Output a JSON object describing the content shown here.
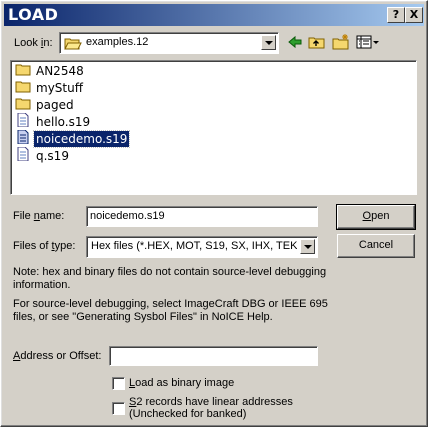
{
  "window": {
    "title": "LOAD",
    "help_btn": "?",
    "close_btn": "X"
  },
  "lookin": {
    "label_pre": "Look ",
    "label_u": "i",
    "label_post": "n:",
    "value": "examples.12"
  },
  "files": [
    {
      "name": "AN2548",
      "type": "folder",
      "selected": false
    },
    {
      "name": "myStuff",
      "type": "folder",
      "selected": false
    },
    {
      "name": "paged",
      "type": "folder",
      "selected": false
    },
    {
      "name": "hello.s19",
      "type": "file",
      "selected": false
    },
    {
      "name": "noicedemo.s19",
      "type": "file",
      "selected": true
    },
    {
      "name": "q.s19",
      "type": "file",
      "selected": false
    }
  ],
  "filename": {
    "label_pre": "File ",
    "label_u": "n",
    "label_post": "ame:",
    "value": "noicedemo.s19"
  },
  "filetype": {
    "label_pre": "Files of ",
    "label_u": "t",
    "label_post": "ype:",
    "value": "Hex files (*.HEX, MOT, S19, SX, IHX, TEK,"
  },
  "buttons": {
    "open_u": "O",
    "open_rest": "pen",
    "cancel": "Cancel"
  },
  "notes": {
    "note1_line1": "Note: hex and binary files do not contain source-level debugging",
    "note1_line2": "information.",
    "note2_line1": "For source-level debugging, select ImageCraft DBG or IEEE 695",
    "note2_line2": "files, or see \"Generating Sysbol Files\" in NoICE Help."
  },
  "address": {
    "label_u": "A",
    "label_rest": "ddress or Offset:",
    "value": ""
  },
  "options": {
    "binary_u": "L",
    "binary_rest": "oad as binary image",
    "s2_u": "S",
    "s2_rest": "2 records have linear addresses",
    "s2_line2": "(Unchecked for banked)"
  }
}
